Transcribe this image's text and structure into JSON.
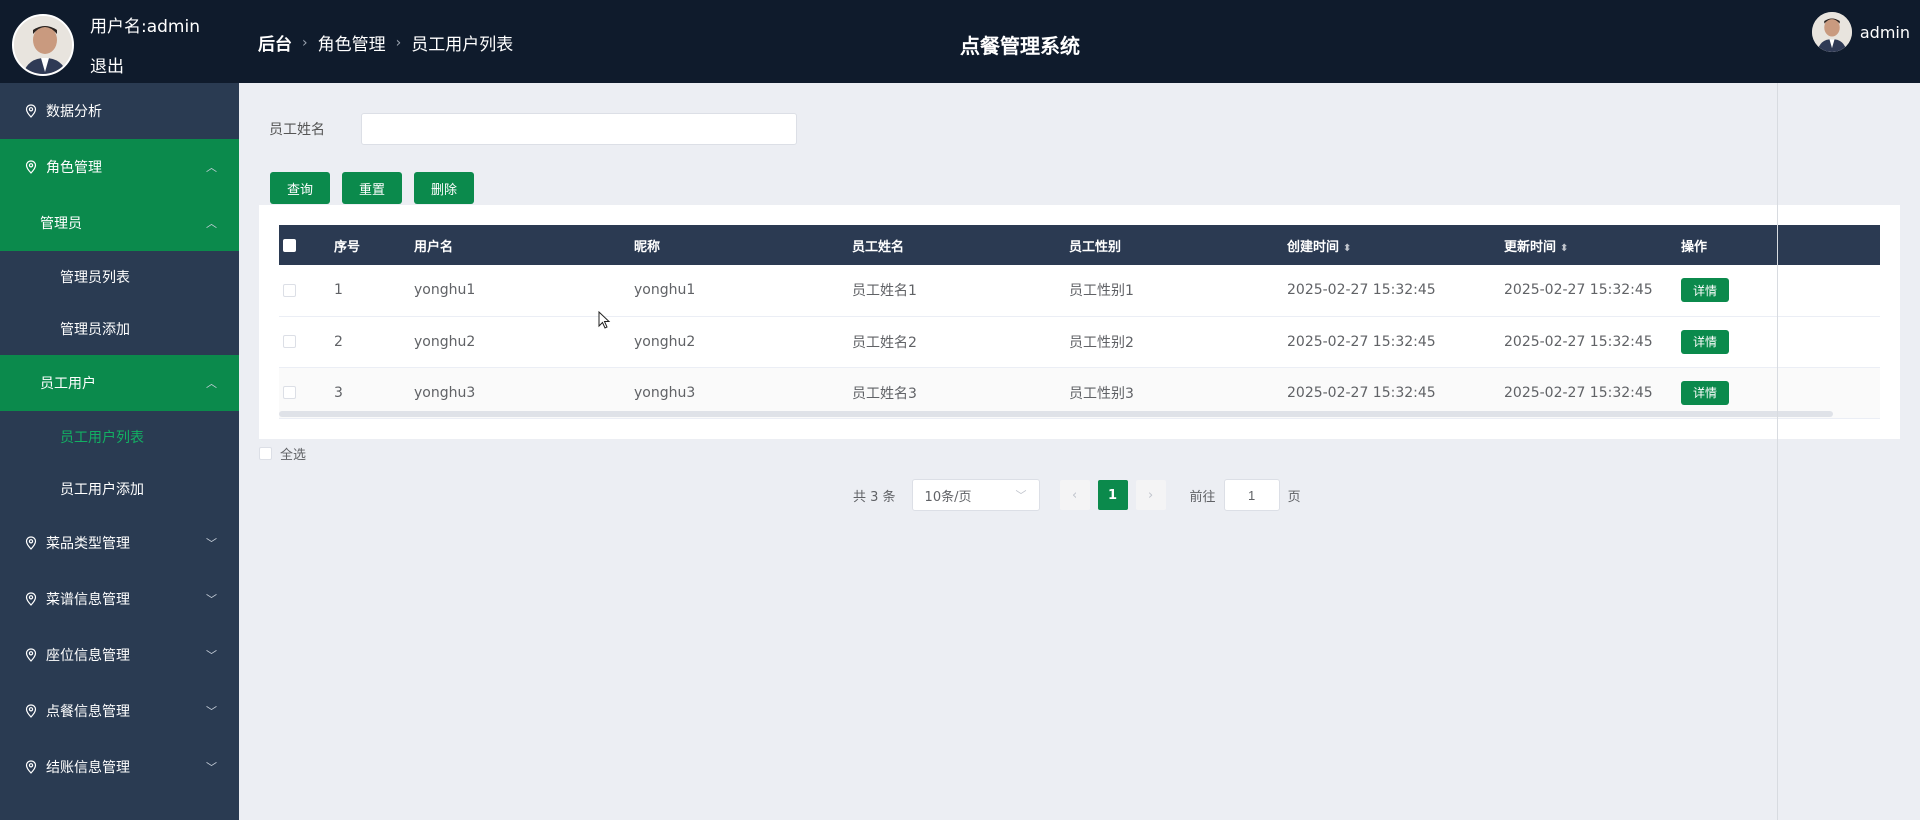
{
  "header": {
    "user_label": "用户名:admin",
    "logout": "退出",
    "breadcrumb": [
      "后台",
      "角色管理",
      "员工用户列表"
    ],
    "system_title": "点餐管理系统",
    "right_user": "admin"
  },
  "sidebar": {
    "items": [
      {
        "label": "数据分析"
      },
      {
        "label": "角色管理"
      },
      {
        "label": "管理员"
      },
      {
        "label": "管理员列表"
      },
      {
        "label": "管理员添加"
      },
      {
        "label": "员工用户"
      },
      {
        "label": "员工用户列表"
      },
      {
        "label": "员工用户添加"
      },
      {
        "label": "菜品类型管理"
      },
      {
        "label": "菜谱信息管理"
      },
      {
        "label": "座位信息管理"
      },
      {
        "label": "点餐信息管理"
      },
      {
        "label": "结账信息管理"
      }
    ]
  },
  "filter": {
    "label": "员工姓名",
    "value": ""
  },
  "buttons": {
    "query": "查询",
    "reset": "重置",
    "delete": "删除"
  },
  "table": {
    "columns": [
      "序号",
      "用户名",
      "昵称",
      "员工姓名",
      "员工性别",
      "创建时间",
      "更新时间",
      "操作"
    ],
    "rows": [
      {
        "index": "1",
        "username": "yonghu1",
        "nickname": "yonghu1",
        "name": "员工姓名1",
        "gender": "员工性别1",
        "created": "2025-02-27 15:32:45",
        "updated": "2025-02-27 15:32:45",
        "action": "详情"
      },
      {
        "index": "2",
        "username": "yonghu2",
        "nickname": "yonghu2",
        "name": "员工姓名2",
        "gender": "员工性别2",
        "created": "2025-02-27 15:32:45",
        "updated": "2025-02-27 15:32:45",
        "action": "详情"
      },
      {
        "index": "3",
        "username": "yonghu3",
        "nickname": "yonghu3",
        "name": "员工姓名3",
        "gender": "员工性别3",
        "created": "2025-02-27 15:32:45",
        "updated": "2025-02-27 15:32:45",
        "action": "详情"
      }
    ]
  },
  "select_all": "全选",
  "pagination": {
    "total": "共 3 条",
    "page_size": "10条/页",
    "current_page": "1",
    "goto_label": "前往",
    "goto_value": "1",
    "goto_suffix": "页"
  },
  "colors": {
    "accent": "#0b8a4c",
    "header_bg": "#0f1b2c",
    "sidebar_bg": "#2a3b52",
    "table_header_bg": "#2b3a52"
  }
}
